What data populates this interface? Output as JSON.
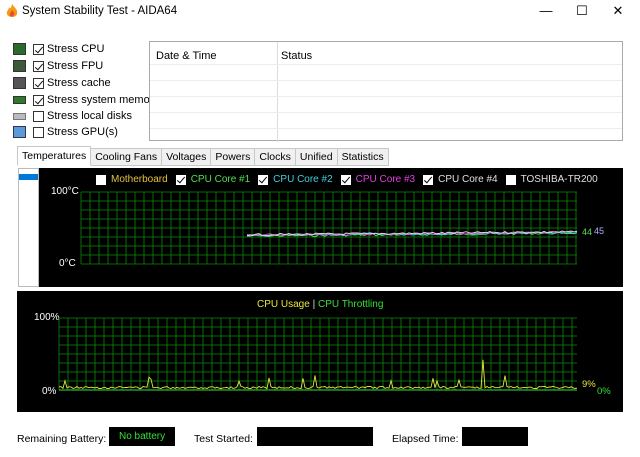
{
  "window": {
    "title": "System Stability Test - AIDA64",
    "minimize": "—",
    "maximize": "☐",
    "close": "✕"
  },
  "stress_options": [
    {
      "label": "Stress CPU",
      "checked": true,
      "icon": "cpu-icon"
    },
    {
      "label": "Stress FPU",
      "checked": true,
      "icon": "fpu-icon"
    },
    {
      "label": "Stress cache",
      "checked": true,
      "icon": "cache-icon"
    },
    {
      "label": "Stress system memory",
      "checked": true,
      "icon": "memory-icon"
    },
    {
      "label": "Stress local disks",
      "checked": false,
      "icon": "disk-icon"
    },
    {
      "label": "Stress GPU(s)",
      "checked": false,
      "icon": "monitor-icon"
    }
  ],
  "log": {
    "col_datetime": "Date & Time",
    "col_status": "Status"
  },
  "tabs": [
    {
      "label": "Temperatures",
      "active": true
    },
    {
      "label": "Cooling Fans",
      "active": false
    },
    {
      "label": "Voltages",
      "active": false
    },
    {
      "label": "Powers",
      "active": false
    },
    {
      "label": "Clocks",
      "active": false
    },
    {
      "label": "Unified",
      "active": false
    },
    {
      "label": "Statistics",
      "active": false
    }
  ],
  "temp_graph": {
    "legend": [
      {
        "label": "Motherboard",
        "checked": false,
        "color": "#e6c23c"
      },
      {
        "label": "CPU Core #1",
        "checked": true,
        "color": "#50e050"
      },
      {
        "label": "CPU Core #2",
        "checked": true,
        "color": "#40d0e0"
      },
      {
        "label": "CPU Core #3",
        "checked": true,
        "color": "#e040e0"
      },
      {
        "label": "CPU Core #4",
        "checked": true,
        "color": "#e0e0e0"
      },
      {
        "label": "TOSHIBA-TR200",
        "checked": false,
        "color": "#e0e0e0"
      }
    ],
    "y_max_label": "100°C",
    "y_min_label": "0°C",
    "current_value": "44",
    "current_value_2": "45",
    "grid_color": "#0a8a0a"
  },
  "cpu_graph": {
    "title_usage": "CPU Usage",
    "separator": "|",
    "title_throttling": "CPU Throttling",
    "usage_color": "#e6e63c",
    "throttling_color": "#36e036",
    "y_max_label": "100%",
    "y_min_label": "0%",
    "usage_value": "9%",
    "throttling_value": "0%"
  },
  "status": {
    "battery_label": "Remaining Battery:",
    "battery_value": "No battery",
    "started_label": "Test Started:",
    "started_value": "",
    "elapsed_label": "Elapsed Time:",
    "elapsed_value": ""
  }
}
